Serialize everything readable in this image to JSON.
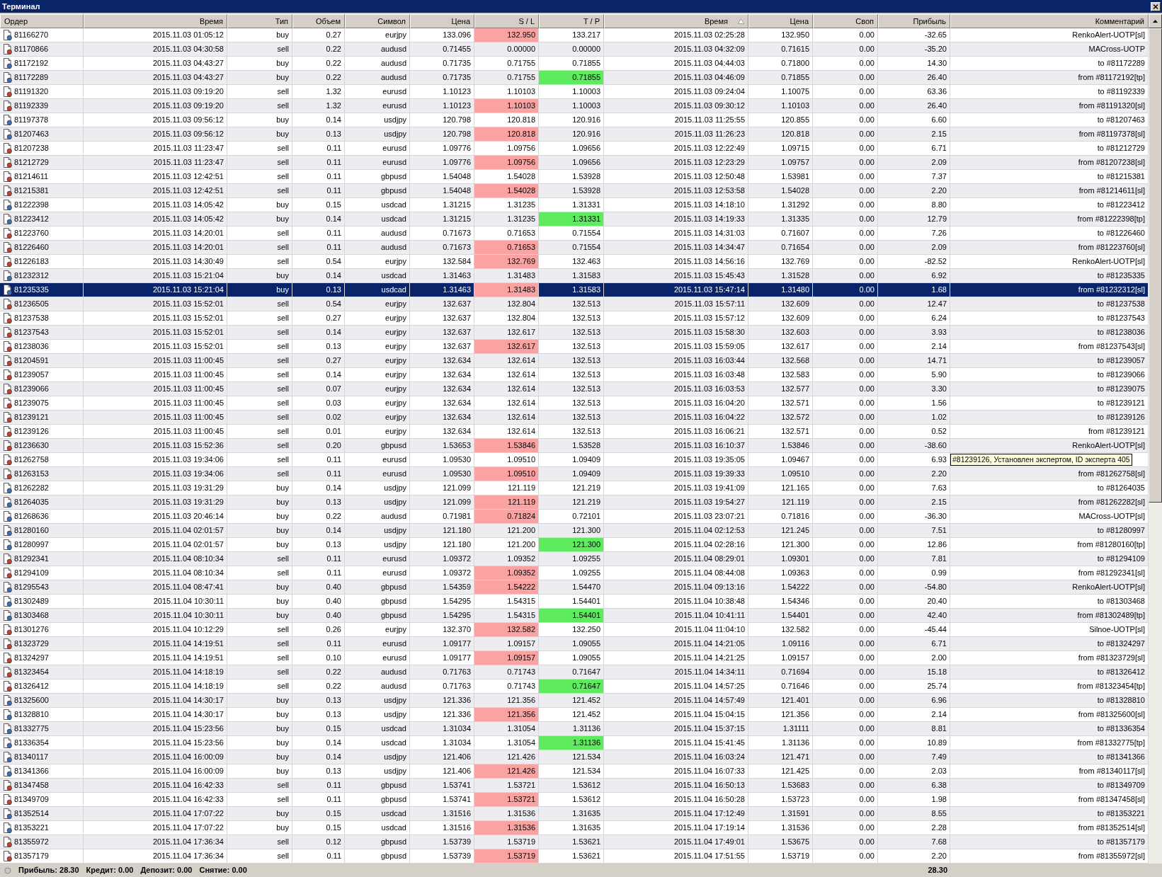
{
  "window": {
    "title": "Терминал"
  },
  "columns": [
    {
      "label": "Ордер",
      "sorted": false
    },
    {
      "label": "Время",
      "sorted": false
    },
    {
      "label": "Тип",
      "sorted": false
    },
    {
      "label": "Объем",
      "sorted": false
    },
    {
      "label": "Символ",
      "sorted": false
    },
    {
      "label": "Цена",
      "sorted": false
    },
    {
      "label": "S / L",
      "sorted": false
    },
    {
      "label": "T / P",
      "sorted": false
    },
    {
      "label": "Время",
      "sorted": true
    },
    {
      "label": "Цена",
      "sorted": false
    },
    {
      "label": "Своп",
      "sorted": false
    },
    {
      "label": "Прибыль",
      "sorted": false
    },
    {
      "label": "Комментарий",
      "sorted": false
    }
  ],
  "rows": [
    {
      "kind": "buy",
      "selected": false,
      "sl_highlight": true,
      "tp_highlight": false,
      "cells": [
        "81166270",
        "2015.11.03 01:05:12",
        "buy",
        "0.27",
        "eurjpy",
        "133.096",
        "132.950",
        "133.217",
        "2015.11.03 02:25:28",
        "132.950",
        "0.00",
        "-32.65",
        "RenkoAlert-UOTP[sl]"
      ]
    },
    {
      "kind": "sell",
      "selected": false,
      "sl_highlight": false,
      "tp_highlight": false,
      "cells": [
        "81170866",
        "2015.11.03 04:30:58",
        "sell",
        "0.22",
        "audusd",
        "0.71455",
        "0.00000",
        "0.00000",
        "2015.11.03 04:32:09",
        "0.71615",
        "0.00",
        "-35.20",
        "MACross-UOTP"
      ]
    },
    {
      "kind": "buy",
      "selected": false,
      "sl_highlight": false,
      "tp_highlight": false,
      "cells": [
        "81172192",
        "2015.11.03 04:43:27",
        "buy",
        "0.22",
        "audusd",
        "0.71735",
        "0.71755",
        "0.71855",
        "2015.11.03 04:44:03",
        "0.71800",
        "0.00",
        "14.30",
        "to #81172289"
      ]
    },
    {
      "kind": "buy",
      "selected": false,
      "sl_highlight": false,
      "tp_highlight": true,
      "cells": [
        "81172289",
        "2015.11.03 04:43:27",
        "buy",
        "0.22",
        "audusd",
        "0.71735",
        "0.71755",
        "0.71855",
        "2015.11.03 04:46:09",
        "0.71855",
        "0.00",
        "26.40",
        "from #81172192[tp]"
      ]
    },
    {
      "kind": "sell",
      "selected": false,
      "sl_highlight": false,
      "tp_highlight": false,
      "cells": [
        "81191320",
        "2015.11.03 09:19:20",
        "sell",
        "1.32",
        "eurusd",
        "1.10123",
        "1.10103",
        "1.10003",
        "2015.11.03 09:24:04",
        "1.10075",
        "0.00",
        "63.36",
        "to #81192339"
      ]
    },
    {
      "kind": "sell",
      "selected": false,
      "sl_highlight": true,
      "tp_highlight": false,
      "cells": [
        "81192339",
        "2015.11.03 09:19:20",
        "sell",
        "1.32",
        "eurusd",
        "1.10123",
        "1.10103",
        "1.10003",
        "2015.11.03 09:30:12",
        "1.10103",
        "0.00",
        "26.40",
        "from #81191320[sl]"
      ]
    },
    {
      "kind": "buy",
      "selected": false,
      "sl_highlight": false,
      "tp_highlight": false,
      "cells": [
        "81197378",
        "2015.11.03 09:56:12",
        "buy",
        "0.14",
        "usdjpy",
        "120.798",
        "120.818",
        "120.916",
        "2015.11.03 11:25:55",
        "120.855",
        "0.00",
        "6.60",
        "to #81207463"
      ]
    },
    {
      "kind": "buy",
      "selected": false,
      "sl_highlight": true,
      "tp_highlight": false,
      "cells": [
        "81207463",
        "2015.11.03 09:56:12",
        "buy",
        "0.13",
        "usdjpy",
        "120.798",
        "120.818",
        "120.916",
        "2015.11.03 11:26:23",
        "120.818",
        "0.00",
        "2.15",
        "from #81197378[sl]"
      ]
    },
    {
      "kind": "sell",
      "selected": false,
      "sl_highlight": false,
      "tp_highlight": false,
      "cells": [
        "81207238",
        "2015.11.03 11:23:47",
        "sell",
        "0.11",
        "eurusd",
        "1.09776",
        "1.09756",
        "1.09656",
        "2015.11.03 12:22:49",
        "1.09715",
        "0.00",
        "6.71",
        "to #81212729"
      ]
    },
    {
      "kind": "sell",
      "selected": false,
      "sl_highlight": true,
      "tp_highlight": false,
      "cells": [
        "81212729",
        "2015.11.03 11:23:47",
        "sell",
        "0.11",
        "eurusd",
        "1.09776",
        "1.09756",
        "1.09656",
        "2015.11.03 12:23:29",
        "1.09757",
        "0.00",
        "2.09",
        "from #81207238[sl]"
      ]
    },
    {
      "kind": "sell",
      "selected": false,
      "sl_highlight": false,
      "tp_highlight": false,
      "cells": [
        "81214611",
        "2015.11.03 12:42:51",
        "sell",
        "0.11",
        "gbpusd",
        "1.54048",
        "1.54028",
        "1.53928",
        "2015.11.03 12:50:48",
        "1.53981",
        "0.00",
        "7.37",
        "to #81215381"
      ]
    },
    {
      "kind": "sell",
      "selected": false,
      "sl_highlight": true,
      "tp_highlight": false,
      "cells": [
        "81215381",
        "2015.11.03 12:42:51",
        "sell",
        "0.11",
        "gbpusd",
        "1.54048",
        "1.54028",
        "1.53928",
        "2015.11.03 12:53:58",
        "1.54028",
        "0.00",
        "2.20",
        "from #81214611[sl]"
      ]
    },
    {
      "kind": "buy",
      "selected": false,
      "sl_highlight": false,
      "tp_highlight": false,
      "cells": [
        "81222398",
        "2015.11.03 14:05:42",
        "buy",
        "0.15",
        "usdcad",
        "1.31215",
        "1.31235",
        "1.31331",
        "2015.11.03 14:18:10",
        "1.31292",
        "0.00",
        "8.80",
        "to #81223412"
      ]
    },
    {
      "kind": "buy",
      "selected": false,
      "sl_highlight": false,
      "tp_highlight": true,
      "cells": [
        "81223412",
        "2015.11.03 14:05:42",
        "buy",
        "0.14",
        "usdcad",
        "1.31215",
        "1.31235",
        "1.31331",
        "2015.11.03 14:19:33",
        "1.31335",
        "0.00",
        "12.79",
        "from #81222398[tp]"
      ]
    },
    {
      "kind": "sell",
      "selected": false,
      "sl_highlight": false,
      "tp_highlight": false,
      "cells": [
        "81223760",
        "2015.11.03 14:20:01",
        "sell",
        "0.11",
        "audusd",
        "0.71673",
        "0.71653",
        "0.71554",
        "2015.11.03 14:31:03",
        "0.71607",
        "0.00",
        "7.26",
        "to #81226460"
      ]
    },
    {
      "kind": "sell",
      "selected": false,
      "sl_highlight": true,
      "tp_highlight": false,
      "cells": [
        "81226460",
        "2015.11.03 14:20:01",
        "sell",
        "0.11",
        "audusd",
        "0.71673",
        "0.71653",
        "0.71554",
        "2015.11.03 14:34:47",
        "0.71654",
        "0.00",
        "2.09",
        "from #81223760[sl]"
      ]
    },
    {
      "kind": "sell",
      "selected": false,
      "sl_highlight": true,
      "tp_highlight": false,
      "cells": [
        "81226183",
        "2015.11.03 14:30:49",
        "sell",
        "0.54",
        "eurjpy",
        "132.584",
        "132.769",
        "132.463",
        "2015.11.03 14:56:16",
        "132.769",
        "0.00",
        "-82.52",
        "RenkoAlert-UOTP[sl]"
      ]
    },
    {
      "kind": "buy",
      "selected": false,
      "sl_highlight": false,
      "tp_highlight": false,
      "cells": [
        "81232312",
        "2015.11.03 15:21:04",
        "buy",
        "0.14",
        "usdcad",
        "1.31463",
        "1.31483",
        "1.31583",
        "2015.11.03 15:45:43",
        "1.31528",
        "0.00",
        "6.92",
        "to #81235335"
      ]
    },
    {
      "kind": "buy",
      "selected": true,
      "sl_highlight": true,
      "tp_highlight": false,
      "cells": [
        "81235335",
        "2015.11.03 15:21:04",
        "buy",
        "0.13",
        "usdcad",
        "1.31463",
        "1.31483",
        "1.31583",
        "2015.11.03 15:47:14",
        "1.31480",
        "0.00",
        "1.68",
        "from #81232312[sl]"
      ]
    },
    {
      "kind": "sell",
      "selected": false,
      "sl_highlight": false,
      "tp_highlight": false,
      "cells": [
        "81236505",
        "2015.11.03 15:52:01",
        "sell",
        "0.54",
        "eurjpy",
        "132.637",
        "132.804",
        "132.513",
        "2015.11.03 15:57:11",
        "132.609",
        "0.00",
        "12.47",
        "to #81237538"
      ]
    },
    {
      "kind": "sell",
      "selected": false,
      "sl_highlight": false,
      "tp_highlight": false,
      "cells": [
        "81237538",
        "2015.11.03 15:52:01",
        "sell",
        "0.27",
        "eurjpy",
        "132.637",
        "132.804",
        "132.513",
        "2015.11.03 15:57:12",
        "132.609",
        "0.00",
        "6.24",
        "to #81237543"
      ]
    },
    {
      "kind": "sell",
      "selected": false,
      "sl_highlight": false,
      "tp_highlight": false,
      "cells": [
        "81237543",
        "2015.11.03 15:52:01",
        "sell",
        "0.14",
        "eurjpy",
        "132.637",
        "132.617",
        "132.513",
        "2015.11.03 15:58:30",
        "132.603",
        "0.00",
        "3.93",
        "to #81238036"
      ]
    },
    {
      "kind": "sell",
      "selected": false,
      "sl_highlight": true,
      "tp_highlight": false,
      "cells": [
        "81238036",
        "2015.11.03 15:52:01",
        "sell",
        "0.13",
        "eurjpy",
        "132.637",
        "132.617",
        "132.513",
        "2015.11.03 15:59:05",
        "132.617",
        "0.00",
        "2.14",
        "from #81237543[sl]"
      ]
    },
    {
      "kind": "sell",
      "selected": false,
      "sl_highlight": false,
      "tp_highlight": false,
      "cells": [
        "81204591",
        "2015.11.03 11:00:45",
        "sell",
        "0.27",
        "eurjpy",
        "132.634",
        "132.614",
        "132.513",
        "2015.11.03 16:03:44",
        "132.568",
        "0.00",
        "14.71",
        "to #81239057"
      ]
    },
    {
      "kind": "sell",
      "selected": false,
      "sl_highlight": false,
      "tp_highlight": false,
      "cells": [
        "81239057",
        "2015.11.03 11:00:45",
        "sell",
        "0.14",
        "eurjpy",
        "132.634",
        "132.614",
        "132.513",
        "2015.11.03 16:03:48",
        "132.583",
        "0.00",
        "5.90",
        "to #81239066"
      ]
    },
    {
      "kind": "sell",
      "selected": false,
      "sl_highlight": false,
      "tp_highlight": false,
      "cells": [
        "81239066",
        "2015.11.03 11:00:45",
        "sell",
        "0.07",
        "eurjpy",
        "132.634",
        "132.614",
        "132.513",
        "2015.11.03 16:03:53",
        "132.577",
        "0.00",
        "3.30",
        "to #81239075"
      ]
    },
    {
      "kind": "sell",
      "selected": false,
      "sl_highlight": false,
      "tp_highlight": false,
      "cells": [
        "81239075",
        "2015.11.03 11:00:45",
        "sell",
        "0.03",
        "eurjpy",
        "132.634",
        "132.614",
        "132.513",
        "2015.11.03 16:04:20",
        "132.571",
        "0.00",
        "1.56",
        "to #81239121"
      ]
    },
    {
      "kind": "sell",
      "selected": false,
      "sl_highlight": false,
      "tp_highlight": false,
      "cells": [
        "81239121",
        "2015.11.03 11:00:45",
        "sell",
        "0.02",
        "eurjpy",
        "132.634",
        "132.614",
        "132.513",
        "2015.11.03 16:04:22",
        "132.572",
        "0.00",
        "1.02",
        "to #81239126"
      ]
    },
    {
      "kind": "sell",
      "selected": false,
      "sl_highlight": false,
      "tp_highlight": false,
      "cells": [
        "81239126",
        "2015.11.03 11:00:45",
        "sell",
        "0.01",
        "eurjpy",
        "132.634",
        "132.614",
        "132.513",
        "2015.11.03 16:06:21",
        "132.571",
        "0.00",
        "0.52",
        "from #81239121"
      ]
    },
    {
      "kind": "sell",
      "selected": false,
      "sl_highlight": true,
      "tp_highlight": false,
      "cells": [
        "81236630",
        "2015.11.03 15:52:36",
        "sell",
        "0.20",
        "gbpusd",
        "1.53653",
        "1.53846",
        "1.53528",
        "2015.11.03 16:10:37",
        "1.53846",
        "0.00",
        "-38.60",
        "RenkoAlert-UOTP[sl]"
      ]
    },
    {
      "kind": "sell",
      "selected": false,
      "sl_highlight": false,
      "tp_highlight": false,
      "cells": [
        "81262758",
        "2015.11.03 19:34:06",
        "sell",
        "0.11",
        "eurusd",
        "1.09530",
        "1.09510",
        "1.09409",
        "2015.11.03 19:35:05",
        "1.09467",
        "0.00",
        "6.93"
      ],
      "tooltip": "#81239126, Установлен экспертом, ID эксперта 405"
    },
    {
      "kind": "sell",
      "selected": false,
      "sl_highlight": true,
      "tp_highlight": false,
      "cells": [
        "81263153",
        "2015.11.03 19:34:06",
        "sell",
        "0.11",
        "eurusd",
        "1.09530",
        "1.09510",
        "1.09409",
        "2015.11.03 19:39:33",
        "1.09510",
        "0.00",
        "2.20",
        "from #81262758[sl]"
      ]
    },
    {
      "kind": "buy",
      "selected": false,
      "sl_highlight": false,
      "tp_highlight": false,
      "cells": [
        "81262282",
        "2015.11.03 19:31:29",
        "buy",
        "0.14",
        "usdjpy",
        "121.099",
        "121.119",
        "121.219",
        "2015.11.03 19:41:09",
        "121.165",
        "0.00",
        "7.63",
        "to #81264035"
      ]
    },
    {
      "kind": "buy",
      "selected": false,
      "sl_highlight": true,
      "tp_highlight": false,
      "cells": [
        "81264035",
        "2015.11.03 19:31:29",
        "buy",
        "0.13",
        "usdjpy",
        "121.099",
        "121.119",
        "121.219",
        "2015.11.03 19:54:27",
        "121.119",
        "0.00",
        "2.15",
        "from #81262282[sl]"
      ]
    },
    {
      "kind": "buy",
      "selected": false,
      "sl_highlight": true,
      "tp_highlight": false,
      "cells": [
        "81268636",
        "2015.11.03 20:46:14",
        "buy",
        "0.22",
        "audusd",
        "0.71981",
        "0.71824",
        "0.72101",
        "2015.11.03 23:07:21",
        "0.71816",
        "0.00",
        "-36.30",
        "MACross-UOTP[sl]"
      ]
    },
    {
      "kind": "buy",
      "selected": false,
      "sl_highlight": false,
      "tp_highlight": false,
      "cells": [
        "81280160",
        "2015.11.04 02:01:57",
        "buy",
        "0.14",
        "usdjpy",
        "121.180",
        "121.200",
        "121.300",
        "2015.11.04 02:12:53",
        "121.245",
        "0.00",
        "7.51",
        "to #81280997"
      ]
    },
    {
      "kind": "buy",
      "selected": false,
      "sl_highlight": false,
      "tp_highlight": true,
      "cells": [
        "81280997",
        "2015.11.04 02:01:57",
        "buy",
        "0.13",
        "usdjpy",
        "121.180",
        "121.200",
        "121.300",
        "2015.11.04 02:28:16",
        "121.300",
        "0.00",
        "12.86",
        "from #81280160[tp]"
      ]
    },
    {
      "kind": "sell",
      "selected": false,
      "sl_highlight": false,
      "tp_highlight": false,
      "cells": [
        "81292341",
        "2015.11.04 08:10:34",
        "sell",
        "0.11",
        "eurusd",
        "1.09372",
        "1.09352",
        "1.09255",
        "2015.11.04 08:29:01",
        "1.09301",
        "0.00",
        "7.81",
        "to #81294109"
      ]
    },
    {
      "kind": "sell",
      "selected": false,
      "sl_highlight": true,
      "tp_highlight": false,
      "cells": [
        "81294109",
        "2015.11.04 08:10:34",
        "sell",
        "0.11",
        "eurusd",
        "1.09372",
        "1.09352",
        "1.09255",
        "2015.11.04 08:44:08",
        "1.09363",
        "0.00",
        "0.99",
        "from #81292341[sl]"
      ]
    },
    {
      "kind": "buy",
      "selected": false,
      "sl_highlight": true,
      "tp_highlight": false,
      "cells": [
        "81295543",
        "2015.11.04 08:47:41",
        "buy",
        "0.40",
        "gbpusd",
        "1.54359",
        "1.54222",
        "1.54470",
        "2015.11.04 09:13:16",
        "1.54222",
        "0.00",
        "-54.80",
        "RenkoAlert-UOTP[sl]"
      ]
    },
    {
      "kind": "buy",
      "selected": false,
      "sl_highlight": false,
      "tp_highlight": false,
      "cells": [
        "81302489",
        "2015.11.04 10:30:11",
        "buy",
        "0.40",
        "gbpusd",
        "1.54295",
        "1.54315",
        "1.54401",
        "2015.11.04 10:38:48",
        "1.54346",
        "0.00",
        "20.40",
        "to #81303468"
      ]
    },
    {
      "kind": "buy",
      "selected": false,
      "sl_highlight": false,
      "tp_highlight": true,
      "cells": [
        "81303468",
        "2015.11.04 10:30:11",
        "buy",
        "0.40",
        "gbpusd",
        "1.54295",
        "1.54315",
        "1.54401",
        "2015.11.04 10:41:11",
        "1.54401",
        "0.00",
        "42.40",
        "from #81302489[tp]"
      ]
    },
    {
      "kind": "sell",
      "selected": false,
      "sl_highlight": true,
      "tp_highlight": false,
      "cells": [
        "81301276",
        "2015.11.04 10:12:29",
        "sell",
        "0.26",
        "eurjpy",
        "132.370",
        "132.582",
        "132.250",
        "2015.11.04 11:04:10",
        "132.582",
        "0.00",
        "-45.44",
        "Silnoe-UOTP[sl]"
      ]
    },
    {
      "kind": "sell",
      "selected": false,
      "sl_highlight": false,
      "tp_highlight": false,
      "cells": [
        "81323729",
        "2015.11.04 14:19:51",
        "sell",
        "0.11",
        "eurusd",
        "1.09177",
        "1.09157",
        "1.09055",
        "2015.11.04 14:21:05",
        "1.09116",
        "0.00",
        "6.71",
        "to #81324297"
      ]
    },
    {
      "kind": "sell",
      "selected": false,
      "sl_highlight": true,
      "tp_highlight": false,
      "cells": [
        "81324297",
        "2015.11.04 14:19:51",
        "sell",
        "0.10",
        "eurusd",
        "1.09177",
        "1.09157",
        "1.09055",
        "2015.11.04 14:21:25",
        "1.09157",
        "0.00",
        "2.00",
        "from #81323729[sl]"
      ]
    },
    {
      "kind": "sell",
      "selected": false,
      "sl_highlight": false,
      "tp_highlight": false,
      "cells": [
        "81323454",
        "2015.11.04 14:18:19",
        "sell",
        "0.22",
        "audusd",
        "0.71763",
        "0.71743",
        "0.71647",
        "2015.11.04 14:34:11",
        "0.71694",
        "0.00",
        "15.18",
        "to #81326412"
      ]
    },
    {
      "kind": "sell",
      "selected": false,
      "sl_highlight": false,
      "tp_highlight": true,
      "cells": [
        "81326412",
        "2015.11.04 14:18:19",
        "sell",
        "0.22",
        "audusd",
        "0.71763",
        "0.71743",
        "0.71647",
        "2015.11.04 14:57:25",
        "0.71646",
        "0.00",
        "25.74",
        "from #81323454[tp]"
      ]
    },
    {
      "kind": "buy",
      "selected": false,
      "sl_highlight": false,
      "tp_highlight": false,
      "cells": [
        "81325600",
        "2015.11.04 14:30:17",
        "buy",
        "0.13",
        "usdjpy",
        "121.336",
        "121.356",
        "121.452",
        "2015.11.04 14:57:49",
        "121.401",
        "0.00",
        "6.96",
        "to #81328810"
      ]
    },
    {
      "kind": "buy",
      "selected": false,
      "sl_highlight": true,
      "tp_highlight": false,
      "cells": [
        "81328810",
        "2015.11.04 14:30:17",
        "buy",
        "0.13",
        "usdjpy",
        "121.336",
        "121.356",
        "121.452",
        "2015.11.04 15:04:15",
        "121.356",
        "0.00",
        "2.14",
        "from #81325600[sl]"
      ]
    },
    {
      "kind": "buy",
      "selected": false,
      "sl_highlight": false,
      "tp_highlight": false,
      "cells": [
        "81332775",
        "2015.11.04 15:23:56",
        "buy",
        "0.15",
        "usdcad",
        "1.31034",
        "1.31054",
        "1.31136",
        "2015.11.04 15:37:15",
        "1.31111",
        "0.00",
        "8.81",
        "to #81336354"
      ]
    },
    {
      "kind": "buy",
      "selected": false,
      "sl_highlight": false,
      "tp_highlight": true,
      "cells": [
        "81336354",
        "2015.11.04 15:23:56",
        "buy",
        "0.14",
        "usdcad",
        "1.31034",
        "1.31054",
        "1.31136",
        "2015.11.04 15:41:45",
        "1.31136",
        "0.00",
        "10.89",
        "from #81332775[tp]"
      ]
    },
    {
      "kind": "buy",
      "selected": false,
      "sl_highlight": false,
      "tp_highlight": false,
      "cells": [
        "81340117",
        "2015.11.04 16:00:09",
        "buy",
        "0.14",
        "usdjpy",
        "121.406",
        "121.426",
        "121.534",
        "2015.11.04 16:03:24",
        "121.471",
        "0.00",
        "7.49",
        "to #81341366"
      ]
    },
    {
      "kind": "buy",
      "selected": false,
      "sl_highlight": true,
      "tp_highlight": false,
      "cells": [
        "81341366",
        "2015.11.04 16:00:09",
        "buy",
        "0.13",
        "usdjpy",
        "121.406",
        "121.426",
        "121.534",
        "2015.11.04 16:07:33",
        "121.425",
        "0.00",
        "2.03",
        "from #81340117[sl]"
      ]
    },
    {
      "kind": "sell",
      "selected": false,
      "sl_highlight": false,
      "tp_highlight": false,
      "cells": [
        "81347458",
        "2015.11.04 16:42:33",
        "sell",
        "0.11",
        "gbpusd",
        "1.53741",
        "1.53721",
        "1.53612",
        "2015.11.04 16:50:13",
        "1.53683",
        "0.00",
        "6.38",
        "to #81349709"
      ]
    },
    {
      "kind": "sell",
      "selected": false,
      "sl_highlight": true,
      "tp_highlight": false,
      "cells": [
        "81349709",
        "2015.11.04 16:42:33",
        "sell",
        "0.11",
        "gbpusd",
        "1.53741",
        "1.53721",
        "1.53612",
        "2015.11.04 16:50:28",
        "1.53723",
        "0.00",
        "1.98",
        "from #81347458[sl]"
      ]
    },
    {
      "kind": "buy",
      "selected": false,
      "sl_highlight": false,
      "tp_highlight": false,
      "cells": [
        "81352514",
        "2015.11.04 17:07:22",
        "buy",
        "0.15",
        "usdcad",
        "1.31516",
        "1.31536",
        "1.31635",
        "2015.11.04 17:12:49",
        "1.31591",
        "0.00",
        "8.55",
        "to #81353221"
      ]
    },
    {
      "kind": "buy",
      "selected": false,
      "sl_highlight": true,
      "tp_highlight": false,
      "cells": [
        "81353221",
        "2015.11.04 17:07:22",
        "buy",
        "0.15",
        "usdcad",
        "1.31516",
        "1.31536",
        "1.31635",
        "2015.11.04 17:19:14",
        "1.31536",
        "0.00",
        "2.28",
        "from #81352514[sl]"
      ]
    },
    {
      "kind": "sell",
      "selected": false,
      "sl_highlight": false,
      "tp_highlight": false,
      "cells": [
        "81355972",
        "2015.11.04 17:36:34",
        "sell",
        "0.12",
        "gbpusd",
        "1.53739",
        "1.53719",
        "1.53621",
        "2015.11.04 17:49:01",
        "1.53675",
        "0.00",
        "7.68",
        "to #81357179"
      ]
    },
    {
      "kind": "sell",
      "selected": false,
      "sl_highlight": true,
      "tp_highlight": false,
      "cells": [
        "81357179",
        "2015.11.04 17:36:34",
        "sell",
        "0.11",
        "gbpusd",
        "1.53739",
        "1.53719",
        "1.53621",
        "2015.11.04 17:51:55",
        "1.53719",
        "0.00",
        "2.20",
        "from #81355972[sl]"
      ]
    }
  ],
  "status_bar": {
    "summary": [
      "Прибыль: 28.30",
      "Кредит: 0.00",
      "Депозит: 0.00",
      "Снятие: 0.00"
    ],
    "total_profit": "28.30"
  }
}
